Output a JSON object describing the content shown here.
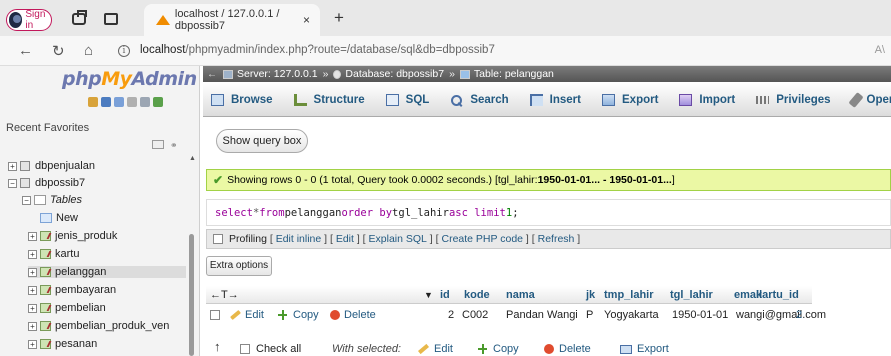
{
  "browser": {
    "signin_label": "Sign in",
    "tab_title": "localhost / 127.0.0.1 / dbpossib7",
    "tab_close": "×",
    "new_tab": "+",
    "url_host": "localhost",
    "url_path": "/phpmyadmin/index.php?route=/database/sql&db=dbpossib7",
    "url_end": "A\\",
    "icons": {
      "back": "back-arrow-icon",
      "reload": "reload-icon",
      "home": "home-icon",
      "info": "info-icon"
    }
  },
  "sidebar": {
    "logo_php": "php",
    "logo_my": "My",
    "logo_admin": "Admin",
    "recent_favorites": "Recent  Favorites",
    "databases": [
      {
        "label": "dbpenjualan"
      },
      {
        "label": "dbpossib7"
      }
    ],
    "tables_group": "Tables",
    "new_label": "New",
    "tables": [
      {
        "label": "jenis_produk"
      },
      {
        "label": "kartu"
      },
      {
        "label": "pelanggan"
      },
      {
        "label": "pembayaran"
      },
      {
        "label": "pembelian"
      },
      {
        "label": "pembelian_produk_ven"
      },
      {
        "label": "pesanan"
      }
    ],
    "quick_icon_colors": [
      "#d8a33a",
      "#4c7cc0",
      "#7aa0d8",
      "#b0b0b0",
      "#9ca6b3",
      "#5aa04a"
    ]
  },
  "breadcrumb": {
    "server_label": "Server: 127.0.0.1",
    "sep1": "»",
    "database_label": "Database: dbpossib7",
    "sep2": "»",
    "table_label": "Table: pelanggan"
  },
  "menu": [
    {
      "label": "Browse",
      "icon": "browse-icon"
    },
    {
      "label": "Structure",
      "icon": "structure-icon"
    },
    {
      "label": "SQL",
      "icon": "sql-icon"
    },
    {
      "label": "Search",
      "icon": "search-icon"
    },
    {
      "label": "Insert",
      "icon": "insert-icon"
    },
    {
      "label": "Export",
      "icon": "export-icon"
    },
    {
      "label": "Import",
      "icon": "import-icon"
    },
    {
      "label": "Privileges",
      "icon": "privileges-icon"
    },
    {
      "label": "Operations",
      "icon": "operations-icon"
    }
  ],
  "show_query_box": "Show query box",
  "success": {
    "text": "Showing rows 0 - 0 (1 total, Query took 0.0002 seconds.) [tgl_lahir: ",
    "range": "1950-01-01... - 1950-01-01...",
    "close": "]"
  },
  "sql": {
    "kw1": "select",
    "star": " * ",
    "kw2": "from",
    "table": " pelanggan ",
    "kw3": "order by",
    "col": " tgl_lahir ",
    "kw4": "asc limit",
    "num": " 1",
    "end": ";"
  },
  "profiling": {
    "label": "Profiling",
    "links": [
      "Edit inline",
      "Edit",
      "Explain SQL",
      "Create PHP code",
      "Refresh"
    ]
  },
  "extra_options": "Extra options",
  "table": {
    "nav_arrows": "←T→",
    "sort_marker": "▼",
    "columns": [
      "id",
      "kode",
      "nama",
      "jk",
      "tmp_lahir",
      "tgl_lahir",
      "email",
      "kartu_id"
    ],
    "row_actions": {
      "edit": "Edit",
      "copy": "Copy",
      "delete": "Delete"
    },
    "rows": [
      {
        "id": "2",
        "kode": "C002",
        "nama": "Pandan Wangi",
        "jk": "P",
        "tmp_lahir": "Yogyakarta",
        "tgl_lahir": "1950-01-01",
        "email": "wangi@gmail.com",
        "kartu_id": "2"
      }
    ]
  },
  "footer": {
    "arrow": "↑",
    "check_all": "Check all",
    "with_selected": "With selected:",
    "edit": "Edit",
    "copy": "Copy",
    "delete": "Delete",
    "export": "Export"
  }
}
